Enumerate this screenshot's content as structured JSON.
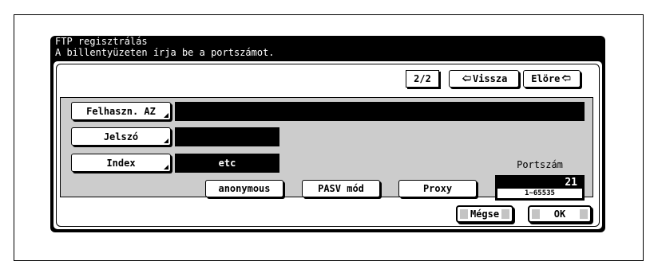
{
  "header": {
    "line1": "FTP regisztrálás",
    "line2": "A billentyüzeten írja be a portszámot."
  },
  "pager": {
    "page": "2/2",
    "back_label": "Vissza",
    "forward_label": "Elöre"
  },
  "fields": {
    "user_id": {
      "label": "Felhaszn. AZ",
      "value": ""
    },
    "password": {
      "label": "Jelszó",
      "value": ""
    },
    "index": {
      "label": "Index",
      "value": "etc"
    }
  },
  "options": {
    "anonymous": "anonymous",
    "pasv": "PASV mód",
    "proxy": "Proxy"
  },
  "port": {
    "label": "Portszám",
    "value": "21",
    "range": "1~65535"
  },
  "footer": {
    "cancel_label": "Mégse",
    "ok_label": "OK"
  },
  "icons": {
    "back": "arrow-left-icon",
    "forward": "arrow-right-icon"
  }
}
